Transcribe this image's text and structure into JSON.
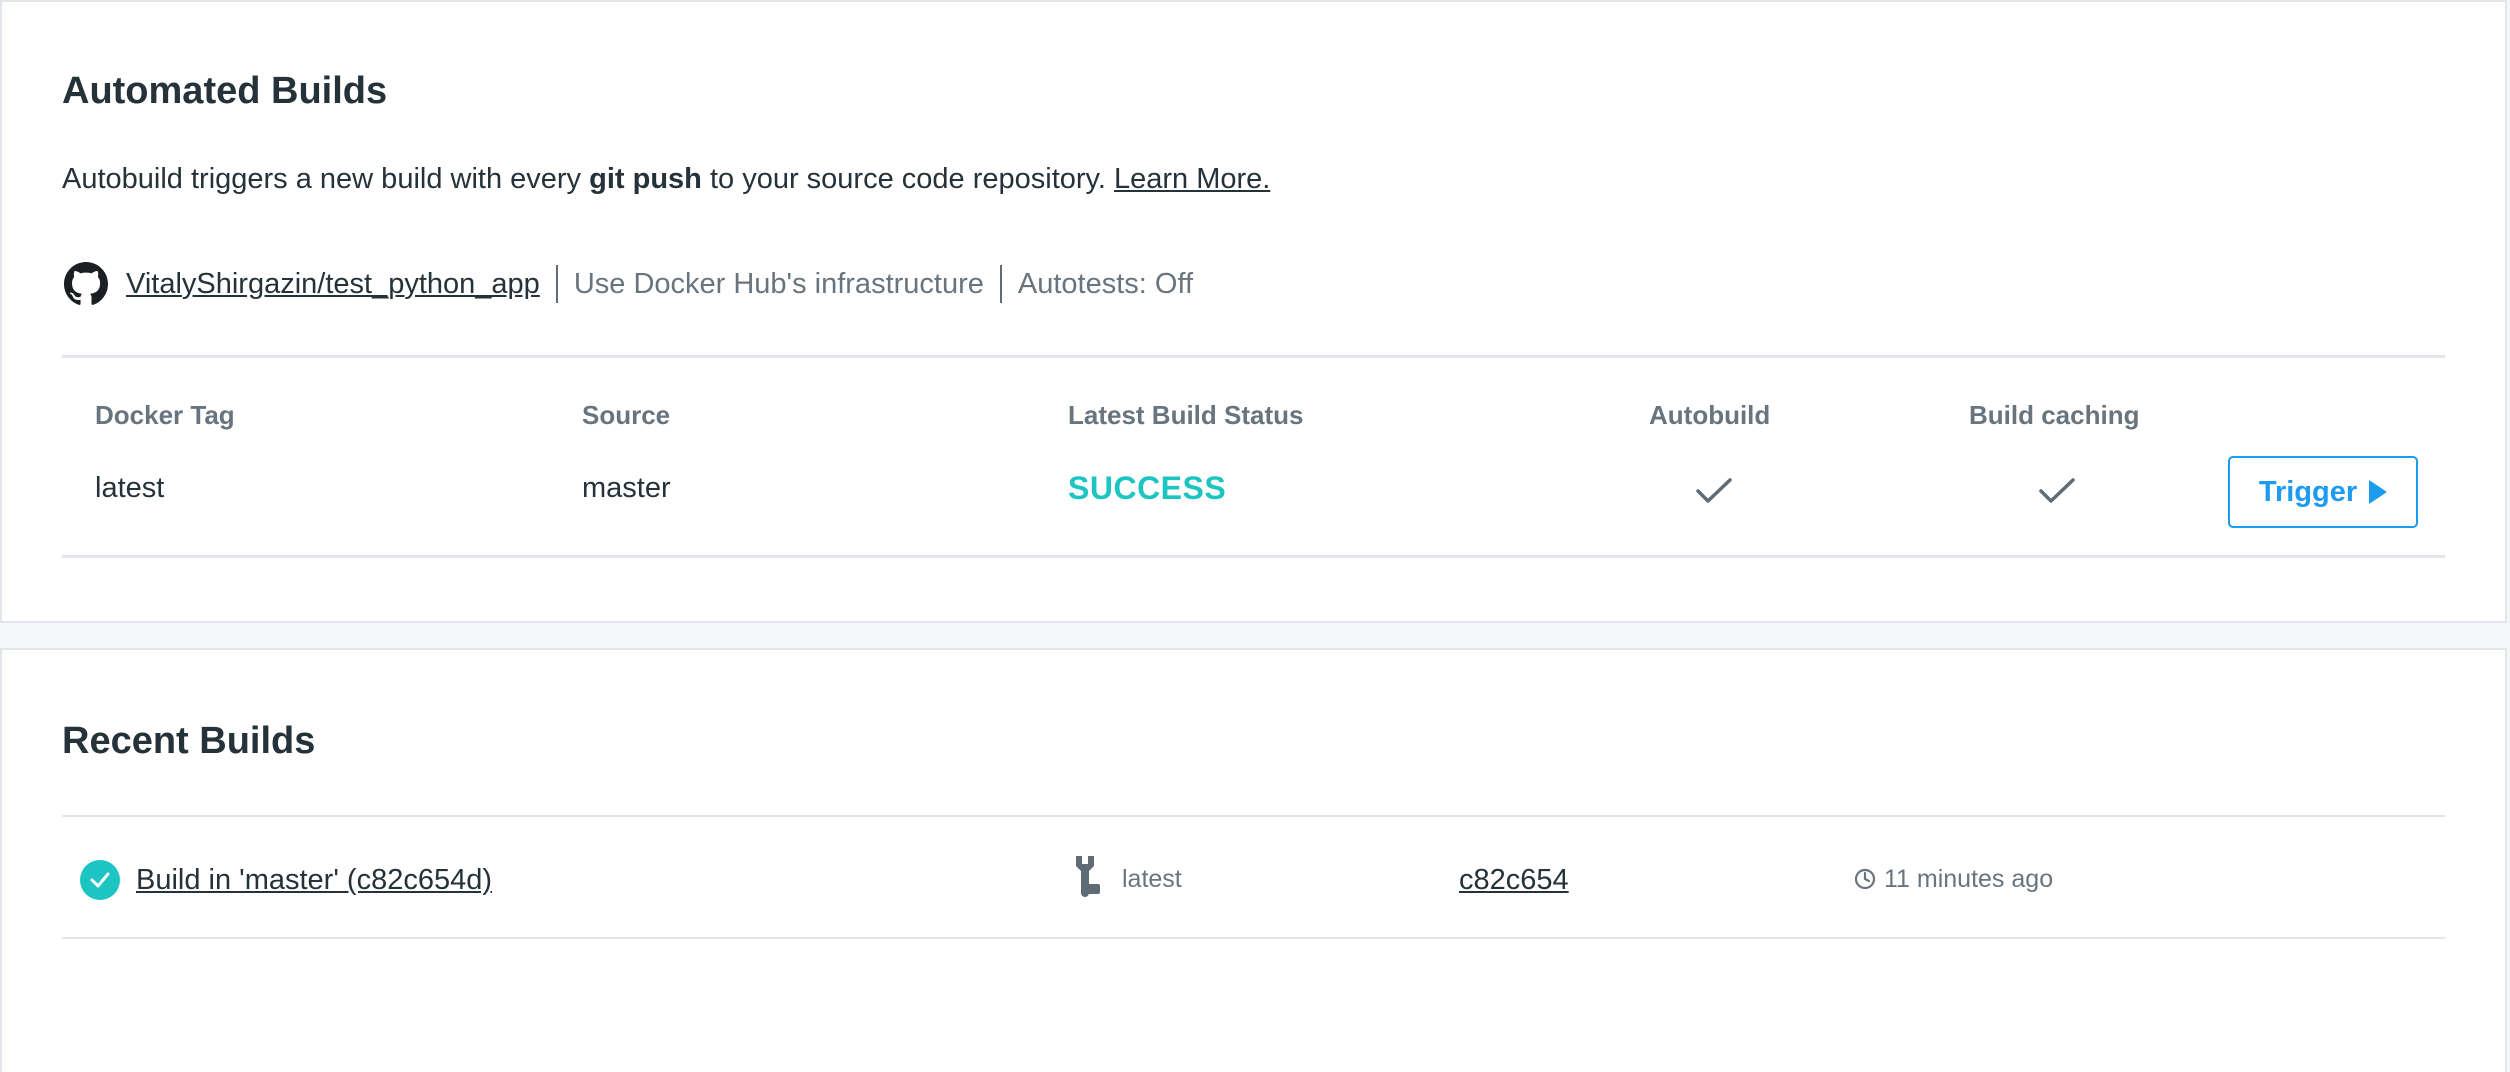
{
  "automated_builds": {
    "title": "Automated Builds",
    "description_prefix": "Autobuild triggers a new build with every ",
    "description_bold": "git push",
    "description_suffix": " to your source code repository. ",
    "learn_more": "Learn More.",
    "repo": "VitalyShirgazin/test_python_app",
    "infrastructure": "Use Docker Hub's infrastructure",
    "autotests": "Autotests: Off",
    "table": {
      "headers": {
        "docker_tag": "Docker Tag",
        "source": "Source",
        "status": "Latest Build Status",
        "autobuild": "Autobuild",
        "caching": "Build caching"
      },
      "row": {
        "docker_tag": "latest",
        "source": "master",
        "status": "SUCCESS",
        "autobuild_enabled": true,
        "caching_enabled": true
      },
      "trigger_label": "Trigger"
    }
  },
  "recent_builds": {
    "title": "Recent Builds",
    "builds": [
      {
        "status_icon": "success-check-icon",
        "name": "Build in 'master' (c82c654d)",
        "tag_icon": "wrench-icon",
        "tag": "latest",
        "commit": "c82c654",
        "time_icon": "clock-icon",
        "time": "11 minutes ago"
      }
    ]
  },
  "colors": {
    "success": "#1cc5c1",
    "accent": "#1c9bf0",
    "text": "#26323a",
    "muted": "#68747e",
    "border": "#e2e6ea"
  }
}
